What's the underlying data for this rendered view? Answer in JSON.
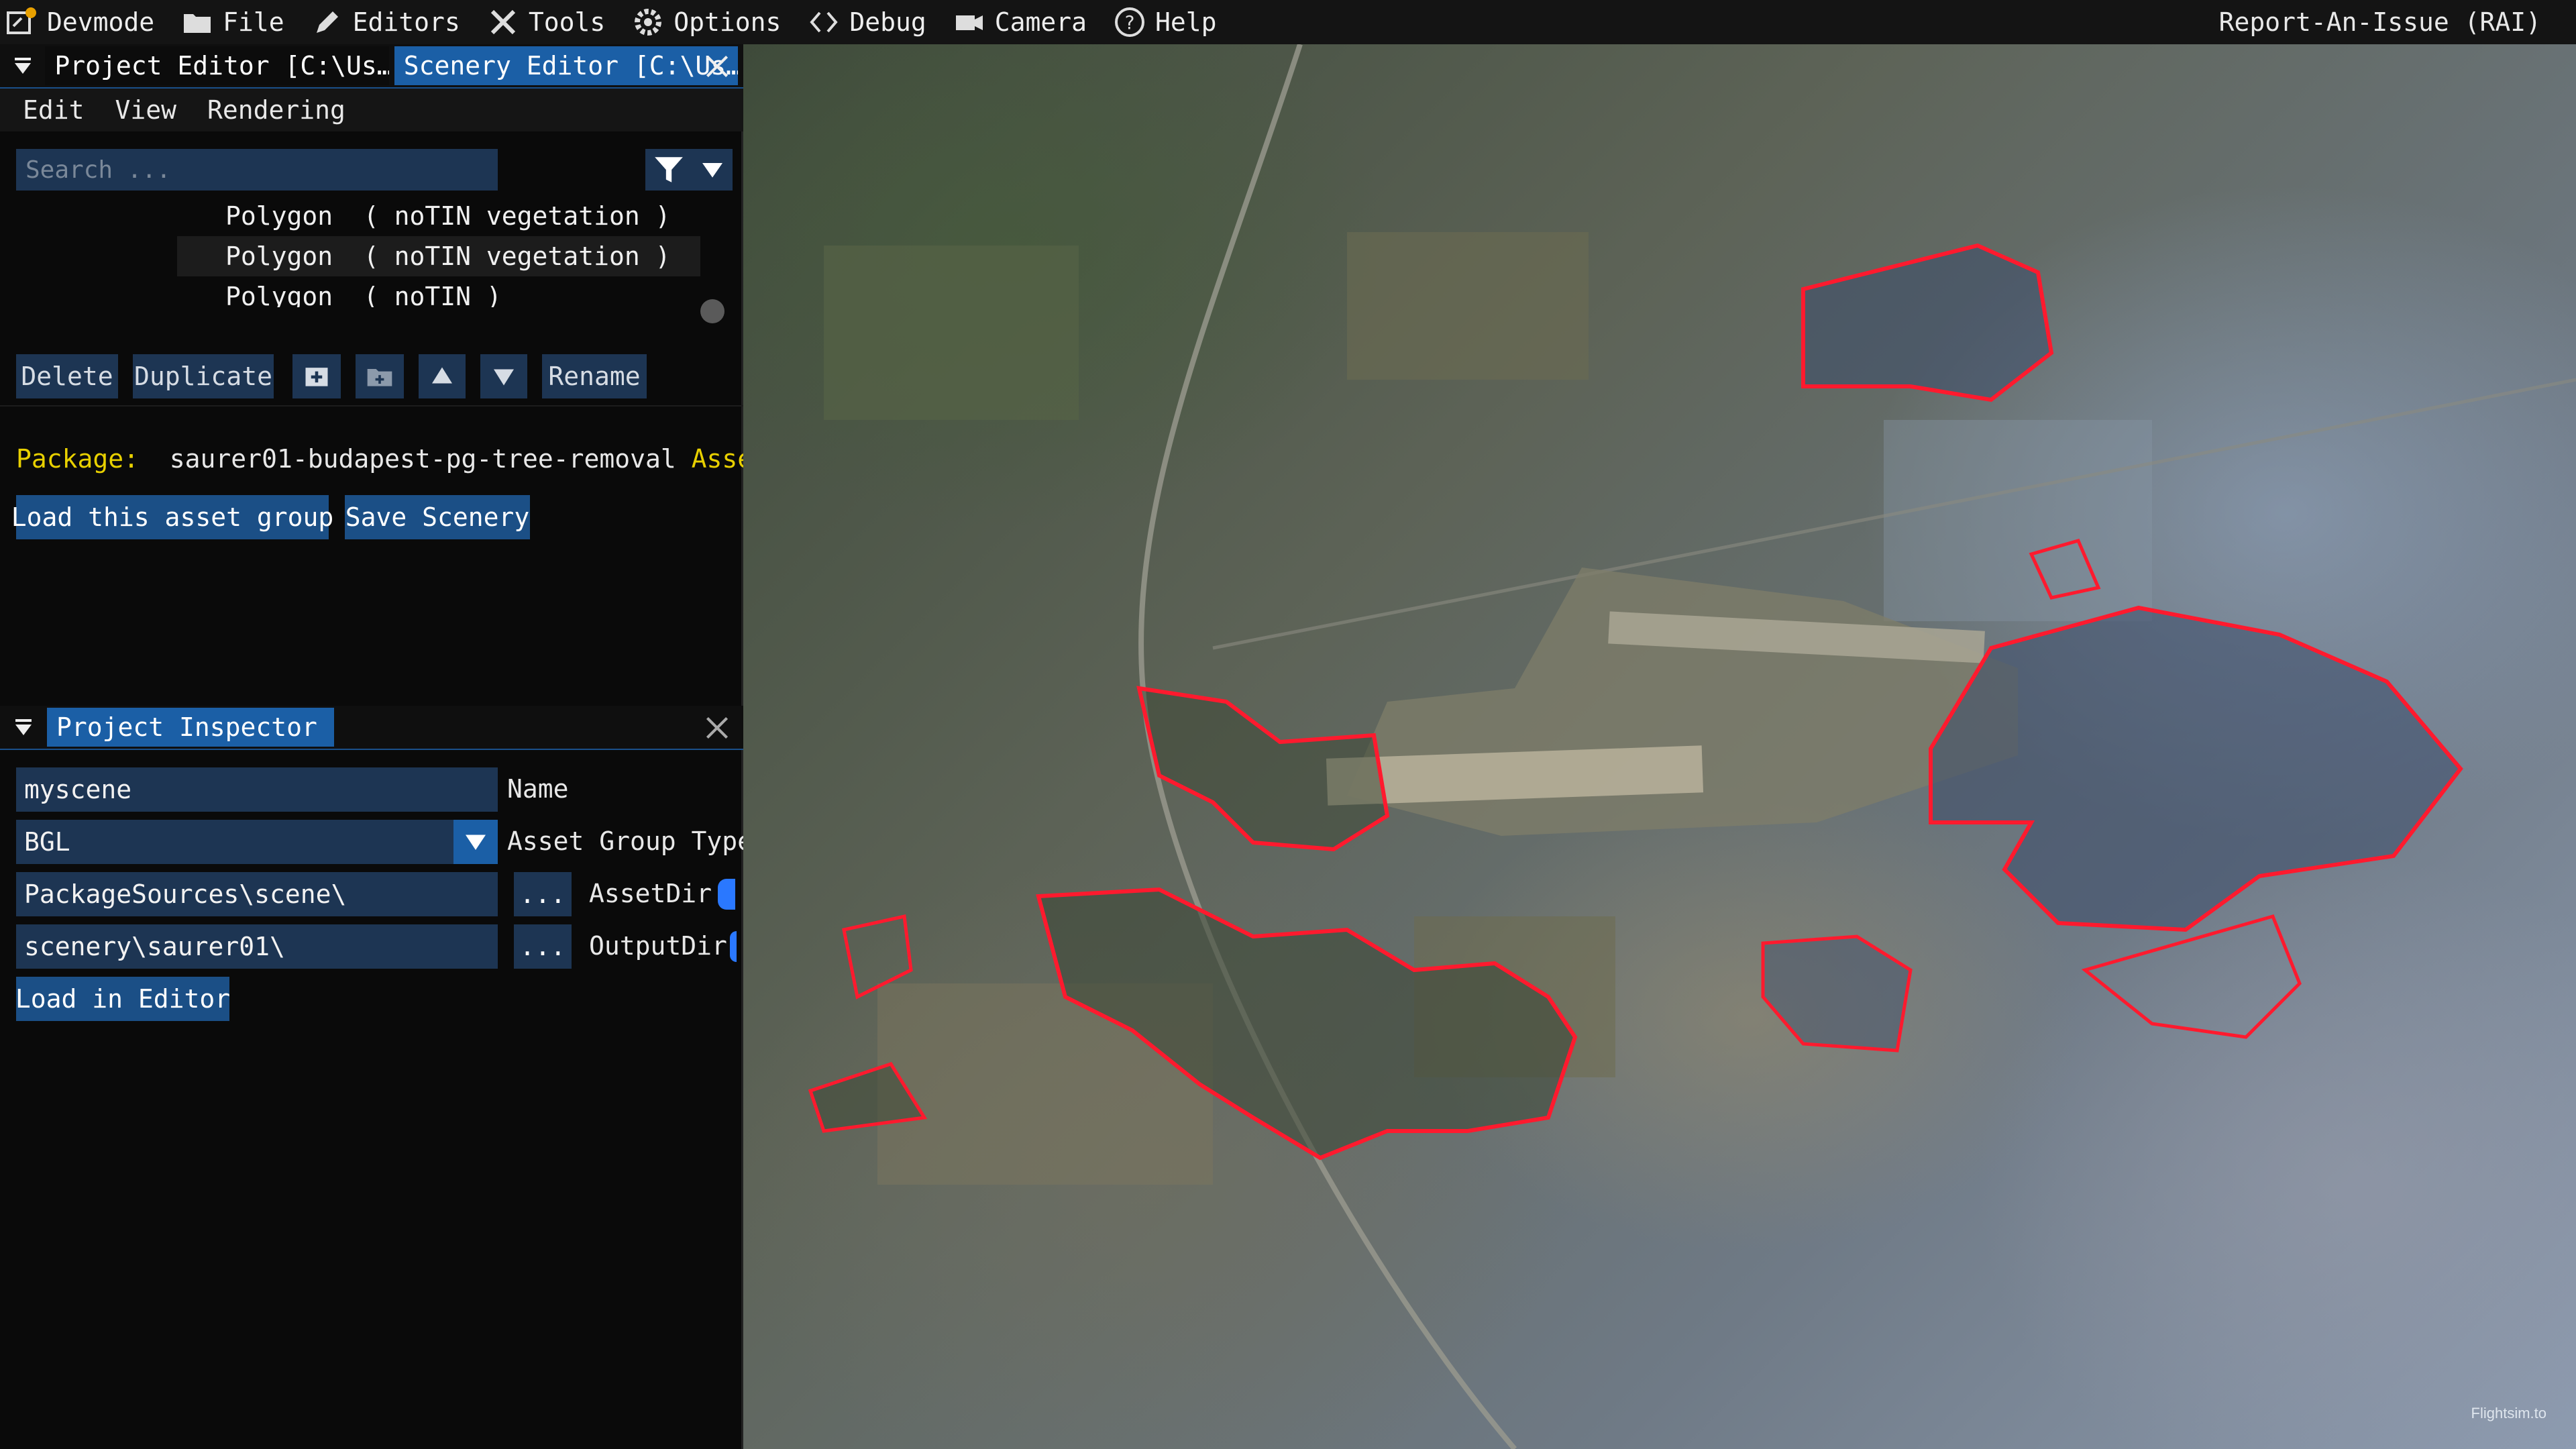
{
  "menubar": {
    "items": [
      {
        "label": "Devmode",
        "icon": "devmode-icon"
      },
      {
        "label": "File",
        "icon": "folder-icon"
      },
      {
        "label": "Editors",
        "icon": "pencil-icon"
      },
      {
        "label": "Tools",
        "icon": "tools-icon"
      },
      {
        "label": "Options",
        "icon": "gear-icon"
      },
      {
        "label": "Debug",
        "icon": "code-icon"
      },
      {
        "label": "Camera",
        "icon": "camera-icon"
      },
      {
        "label": "Help",
        "icon": "help-icon"
      }
    ],
    "report_label": "Report-An-Issue (RAI)"
  },
  "scenery_editor": {
    "tabs": [
      {
        "label": "Project Editor [C:\\Us…",
        "active": false
      },
      {
        "label": "Scenery Editor [C:\\Us…",
        "active": true
      }
    ],
    "menu": [
      "Edit",
      "View",
      "Rendering"
    ],
    "search_placeholder": "Search ...",
    "list_items": [
      "Polygon  ( noTIN vegetation )",
      "Polygon  ( noTIN vegetation )",
      "Polygon  ( noTIN )"
    ],
    "buttons": {
      "delete": "Delete",
      "duplicate": "Duplicate",
      "rename": "Rename"
    },
    "package_label": "Package:",
    "package_name": "saurer01-budapest-pg-tree-removal",
    "asset_label": "Asset:",
    "load_group_label": "Load this asset group",
    "save_scenery_label": "Save Scenery"
  },
  "inspector": {
    "tab_label": "Project Inspector",
    "name_value": "myscene",
    "name_label": "Name",
    "type_value": "BGL",
    "type_label": "Asset Group Type",
    "asset_dir_value": "PackageSources\\scene\\",
    "asset_dir_label": "AssetDir",
    "output_dir_value": "scenery\\saurer01\\",
    "output_dir_label": "OutputDir",
    "browse_label": "...",
    "load_editor_label": "Load in Editor"
  },
  "map": {
    "watermark": "Flightsim.to",
    "polygon_color": "#ff1a2e"
  }
}
